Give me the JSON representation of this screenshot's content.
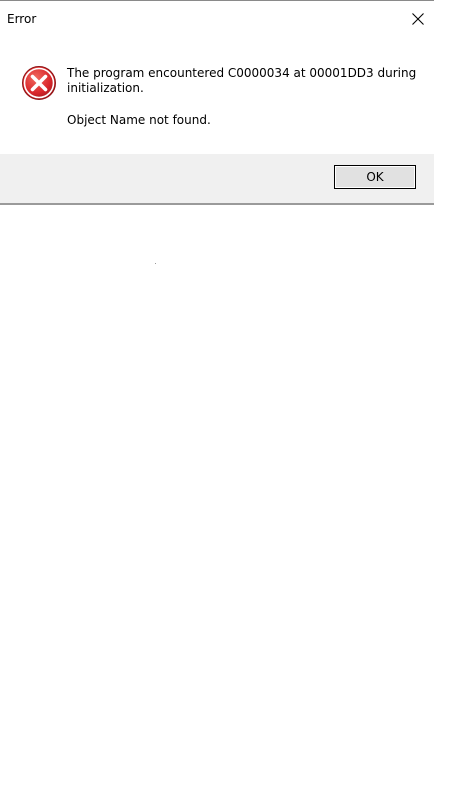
{
  "window": {
    "title": "Error",
    "close_icon": "close-icon"
  },
  "message": {
    "icon": "error-icon",
    "text": "The program encountered C0000034 at 00001DD3 during initialization.",
    "detail": "Object Name not found."
  },
  "buttons": {
    "ok_label": "OK"
  },
  "colors": {
    "error_red": "#d9262b",
    "footer_bg": "#f0f0f0",
    "button_bg": "#e1e1e1"
  }
}
